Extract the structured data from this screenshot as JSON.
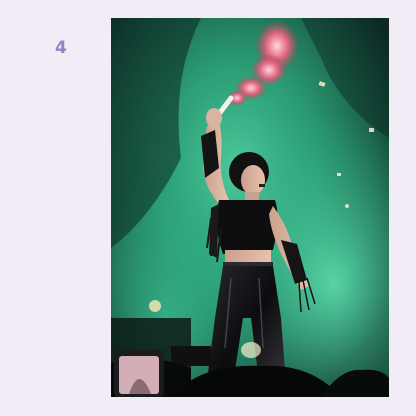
{
  "page": {
    "number": "4"
  },
  "photo": {
    "subject": "concert-performer",
    "colors": {
      "smoke_green": "#2fb083",
      "smoke_deep": "#0f3a30",
      "flare_pink": "#e2657f",
      "background_dark": "#0a1512",
      "page_bg": "#f1ecf6",
      "number_color": "#8f86c9"
    }
  }
}
